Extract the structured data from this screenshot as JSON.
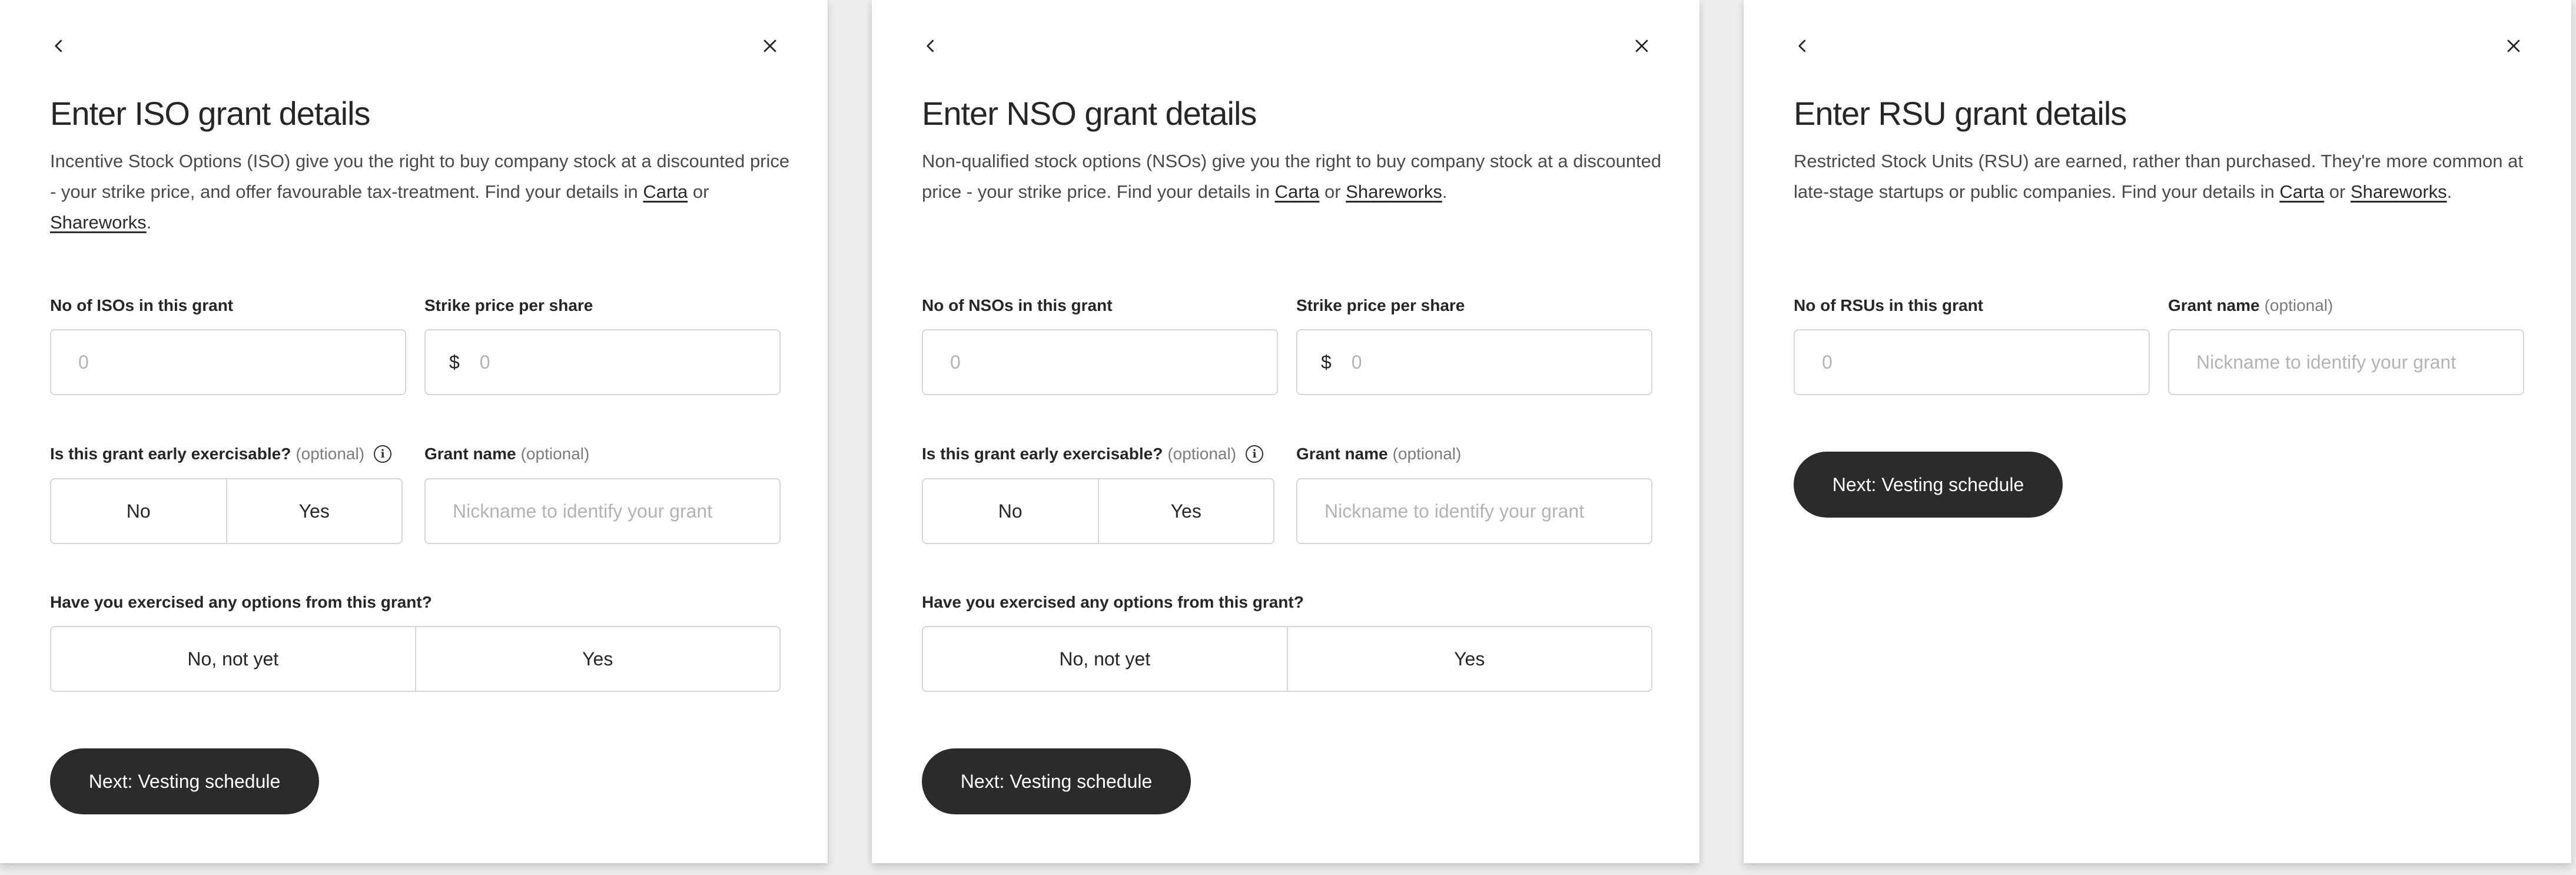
{
  "icons": {
    "back": "chevron-left-icon",
    "close": "close-icon",
    "info": "info-icon"
  },
  "iso": {
    "title": "Enter ISO grant details",
    "desc_text": "Incentive Stock Options (ISO) give you the right to buy company stock at a discounted price - your strike price, and offer favourable tax-treatment. Find your details in ",
    "link1": "Carta",
    "desc_or": " or ",
    "link2": "Shareworks",
    "desc_end": ".",
    "count_label": "No of ISOs in this grant",
    "count_placeholder": "0",
    "strike_label": "Strike price per share",
    "currency": "$",
    "strike_placeholder": "0",
    "early_label": "Is this grant early exercisable?",
    "optional": "(optional)",
    "early_no": "No",
    "early_yes": "Yes",
    "name_label": "Grant name",
    "name_placeholder": "Nickname to identify your grant",
    "exercised_label": "Have you exercised any options from this grant?",
    "exercised_no": "No, not yet",
    "exercised_yes": "Yes",
    "next_button": "Next: Vesting schedule"
  },
  "nso": {
    "title": "Enter NSO grant details",
    "desc_text": "Non-qualified stock options (NSOs) give you the right to buy company stock at a discounted price - your strike price. Find your details in ",
    "link1": "Carta",
    "desc_or": " or ",
    "link2": "Shareworks",
    "desc_end": ".",
    "count_label": "No of NSOs in this grant",
    "count_placeholder": "0",
    "strike_label": "Strike price per share",
    "currency": "$",
    "strike_placeholder": "0",
    "early_label": "Is this grant early exercisable?",
    "optional": "(optional)",
    "early_no": "No",
    "early_yes": "Yes",
    "name_label": "Grant name",
    "name_placeholder": "Nickname to identify your grant",
    "exercised_label": "Have you exercised any options from this grant?",
    "exercised_no": "No, not yet",
    "exercised_yes": "Yes",
    "next_button": "Next: Vesting schedule"
  },
  "rsu": {
    "title": "Enter RSU grant details",
    "desc_text": "Restricted Stock Units (RSU) are earned, rather than purchased. They're more common at late-stage startups or public companies. Find your details in ",
    "link1": "Carta",
    "desc_or": " or ",
    "link2": "Shareworks",
    "desc_end": ".",
    "count_label": "No of RSUs in this grant",
    "count_placeholder": "0",
    "name_label": "Grant name",
    "optional": "(optional)",
    "name_placeholder": "Nickname to identify your grant",
    "next_button": "Next: Vesting schedule"
  }
}
